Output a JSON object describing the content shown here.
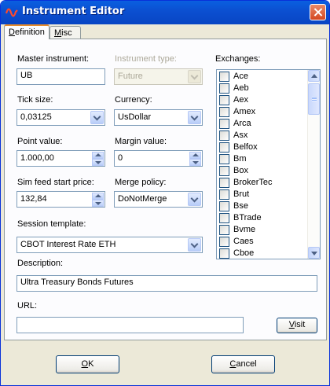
{
  "window": {
    "title": "Instrument Editor"
  },
  "tabs": [
    {
      "label": "Definition",
      "accel": "D",
      "rest": "efinition"
    },
    {
      "label": "Misc",
      "accel": "M",
      "rest": "isc"
    }
  ],
  "form": {
    "master_instrument": {
      "label": "Master instrument:",
      "value": "UB"
    },
    "instrument_type": {
      "label": "Instrument type:",
      "value": "Future"
    },
    "tick_size": {
      "label": "Tick size:",
      "value": "0,03125"
    },
    "currency": {
      "label": "Currency:",
      "value": "UsDollar"
    },
    "point_value": {
      "label": "Point value:",
      "value": "1.000,00"
    },
    "margin_value": {
      "label": "Margin value:",
      "value": "0"
    },
    "sim_feed_start_price": {
      "label": "Sim feed start price:",
      "value": "132,84"
    },
    "merge_policy": {
      "label": "Merge policy:",
      "value": "DoNotMerge"
    },
    "session_template": {
      "label": "Session template:",
      "value": "CBOT Interest Rate ETH"
    },
    "description": {
      "label": "Description:",
      "value": "Ultra Treasury Bonds Futures"
    },
    "url": {
      "label": "URL:",
      "value": ""
    }
  },
  "exchanges": {
    "label": "Exchanges:",
    "items": [
      "Ace",
      "Aeb",
      "Aex",
      "Amex",
      "Arca",
      "Asx",
      "Belfox",
      "Bm",
      "Box",
      "BrokerTec",
      "Brut",
      "Bse",
      "BTrade",
      "Bvme",
      "Caes",
      "Cboe"
    ]
  },
  "buttons": {
    "visit": {
      "label": "Visit",
      "accel": "V",
      "rest": "isit"
    },
    "ok": {
      "label": "OK",
      "accel": "O",
      "rest": "K"
    },
    "cancel": {
      "label": "Cancel",
      "accel": "C",
      "rest": "ancel"
    }
  }
}
